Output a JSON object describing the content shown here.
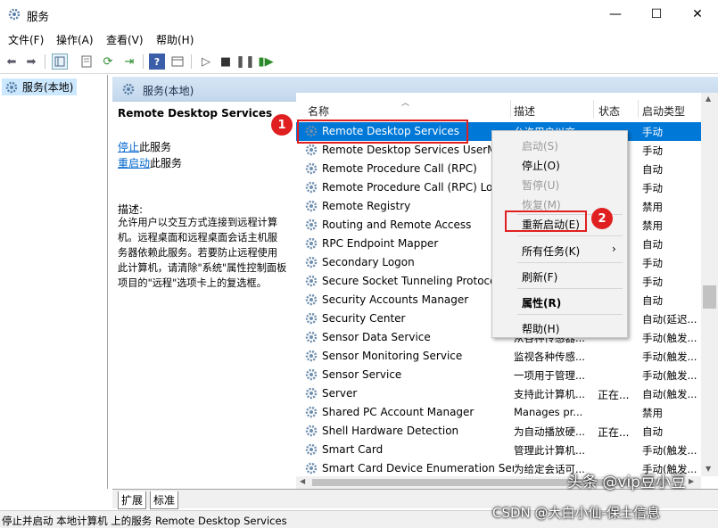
{
  "window": {
    "title": "服务",
    "minimize_glyph": "—",
    "maximize_glyph": "☐",
    "close_glyph": "✕"
  },
  "menu": [
    "文件(F)",
    "操作(A)",
    "查看(V)",
    "帮助(H)"
  ],
  "tree": {
    "selected": "服务(本地)"
  },
  "main_header": "服务(本地)",
  "left_panel": {
    "service_title": "Remote Desktop Services",
    "stop_link": "停止",
    "stop_suffix": "此服务",
    "restart_link": "重启动",
    "restart_suffix": "此服务",
    "desc_label": "描述:",
    "desc_lines": [
      "允许用户以交互方式连接到远程计算",
      "机。远程桌面和远程桌面会话主机服",
      "务器依赖此服务。若要防止远程使用",
      "此计算机，请清除\"系统\"属性控制面板",
      "项目的\"远程\"选项卡上的复选框。"
    ]
  },
  "columns": {
    "name": "名称",
    "description": "描述",
    "status": "状态",
    "startup": "启动类型"
  },
  "services": [
    {
      "name": "Remote Desktop Services",
      "desc": "允许用户以交",
      "status": "",
      "startup": "手动"
    },
    {
      "name": "Remote Desktop Services UserMode Port Redirector",
      "desc": "",
      "status": "",
      "startup": "手动"
    },
    {
      "name": "Remote Procedure Call (RPC)",
      "desc": "",
      "status": "",
      "startup": "自动"
    },
    {
      "name": "Remote Procedure Call (RPC) Locator",
      "desc": "",
      "status": "",
      "startup": "手动"
    },
    {
      "name": "Remote Registry",
      "desc": "",
      "status": "",
      "startup": "禁用"
    },
    {
      "name": "Routing and Remote Access",
      "desc": "",
      "status": "",
      "startup": "禁用"
    },
    {
      "name": "RPC Endpoint Mapper",
      "desc": "",
      "status": "",
      "startup": "自动"
    },
    {
      "name": "Secondary Logon",
      "desc": "",
      "status": "",
      "startup": "手动"
    },
    {
      "name": "Secure Socket Tunneling Protocol Service",
      "desc": "",
      "status": "",
      "startup": "手动"
    },
    {
      "name": "Security Accounts Manager",
      "desc": "",
      "status": "",
      "startup": "自动"
    },
    {
      "name": "Security Center",
      "desc": "",
      "status": "",
      "startup": "自动(延迟..."
    },
    {
      "name": "Sensor Data Service",
      "desc": "从各种传感器...",
      "status": "",
      "startup": "手动(触发..."
    },
    {
      "name": "Sensor Monitoring Service",
      "desc": "监视各种传感...",
      "status": "",
      "startup": "手动(触发..."
    },
    {
      "name": "Sensor Service",
      "desc": "一项用于管理...",
      "status": "",
      "startup": "手动(触发..."
    },
    {
      "name": "Server",
      "desc": "支持此计算机...",
      "status": "正在...",
      "startup": "自动(触发..."
    },
    {
      "name": "Shared PC Account Manager",
      "desc": "Manages pr...",
      "status": "",
      "startup": "禁用"
    },
    {
      "name": "Shell Hardware Detection",
      "desc": "为自动播放硬...",
      "status": "正在...",
      "startup": "自动"
    },
    {
      "name": "Smart Card",
      "desc": "管理此计算机...",
      "status": "",
      "startup": "手动(触发..."
    },
    {
      "name": "Smart Card Device Enumeration Service",
      "desc": "为给定会话可...",
      "status": "",
      "startup": "手动(触发..."
    }
  ],
  "context_menu": {
    "start": "启动(S)",
    "stop": "停止(O)",
    "pause": "暂停(U)",
    "resume": "恢复(M)",
    "restart": "重新启动(E)",
    "all_tasks": "所有任务(K)",
    "refresh": "刷新(F)",
    "properties": "属性(R)",
    "help": "帮助(H)"
  },
  "annotations": {
    "badge1": "1",
    "badge2": "2"
  },
  "tabs": [
    "扩展",
    "标准"
  ],
  "statusbar": "停止并启动 本地计算机 上的服务 Remote Desktop Services",
  "watermark": {
    "line1": "头条 @vip豆小豆",
    "line2": "CSDN @大白小仙-保士信息"
  },
  "colors": {
    "selection": "#0078d7",
    "header_gradient_top": "#d6e6f5",
    "annotation_red": "#e02020",
    "link": "#0066cc"
  }
}
